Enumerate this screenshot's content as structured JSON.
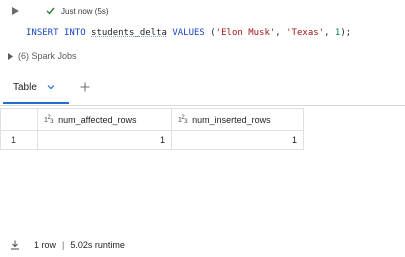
{
  "cell": {
    "status_text": "Just now (5s)",
    "code": {
      "kw_insert": "INSERT",
      "kw_into": "INTO",
      "table_name": "students_delta",
      "kw_values": "VALUES",
      "open_paren": "(",
      "str_name": "'Elon Musk'",
      "comma1": ", ",
      "str_state": "'Texas'",
      "comma2": ", ",
      "num_id": "1",
      "close": ");"
    },
    "spark_jobs": "(6) Spark Jobs"
  },
  "results": {
    "tabs": [
      {
        "label": "Table"
      }
    ],
    "columns": [
      {
        "name": "num_affected_rows",
        "type_icon": "1²3"
      },
      {
        "name": "num_inserted_rows",
        "type_icon": "1²3"
      }
    ],
    "rows": [
      {
        "index": "1",
        "values": [
          "1",
          "1"
        ]
      }
    ]
  },
  "footer": {
    "row_count": "1 row",
    "separator": "|",
    "runtime": "5.02s runtime"
  },
  "colors": {
    "accent": "#1f6fd1",
    "success": "#2e7d32",
    "keyword": "#1a44c0",
    "string": "#a31515"
  }
}
